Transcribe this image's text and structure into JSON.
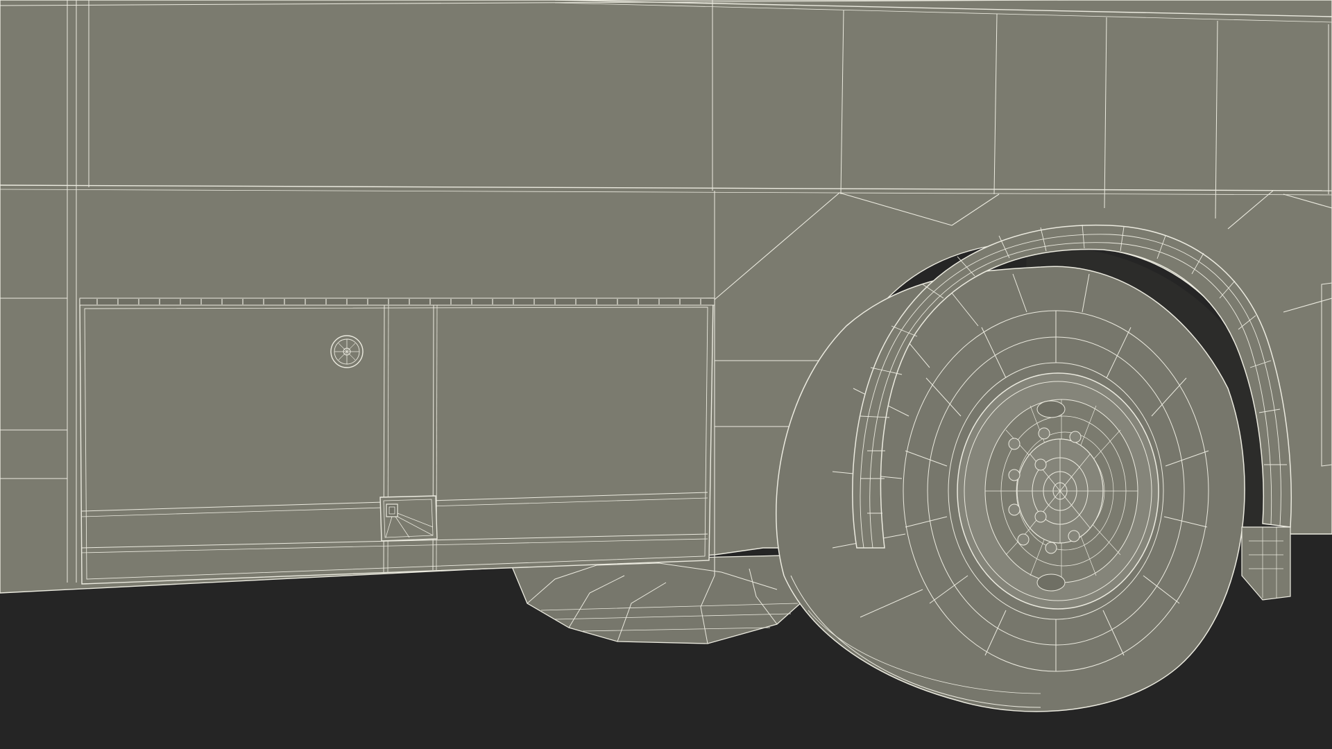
{
  "scene": {
    "subject": "bus-side-wireframe-render",
    "colors": {
      "background": "#252525",
      "body_panel": "#7b7b6f",
      "body_panel_dark": "#6f6f64",
      "wire": "#ecebe0",
      "tire": "#77776c",
      "tire_shadow": "#5d5d54",
      "wheel_well": "#2c2c2a",
      "hub": "#85857a"
    },
    "icons": [
      "fuel-cap-icon",
      "panel-latch-icon",
      "wheel-hub-icon",
      "lug-nut-icon"
    ]
  }
}
